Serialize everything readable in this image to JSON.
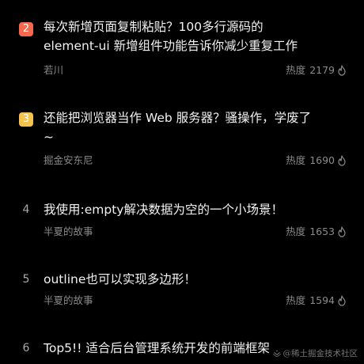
{
  "colors": {
    "background": "#000000",
    "rank_2_badge": "#f5694e",
    "rank_3_badge": "#f7c34f",
    "meta_text": "#8a8a8a"
  },
  "items": [
    {
      "rank": "2",
      "title_line1": "每次新增页面复制粘贴？100多行源码的",
      "title_line2": "element-ui 新增组件功能告诉你减少重复工作",
      "author": "若川",
      "heat_label": "热度",
      "heat_value": "2179",
      "heat_icon": "flame-icon"
    },
    {
      "rank": "3",
      "title_line1": "还能把浏览器当作 Web 服务器？骚操作，学废了",
      "title_line2": "~",
      "author": "掘金安东尼",
      "heat_label": "热度",
      "heat_value": "1690",
      "heat_icon": "flame-icon"
    },
    {
      "rank": "4",
      "title_line1": "我使用:empty解决数据为空的一个小场景！",
      "author": "半夏的故事",
      "heat_label": "热度",
      "heat_value": "1653",
      "heat_icon": "flame-icon"
    },
    {
      "rank": "5",
      "title_line1": "outline也可以实现多边形！",
      "author": "半夏的故事",
      "heat_label": "热度",
      "heat_value": "1594",
      "heat_icon": "flame-icon"
    },
    {
      "rank": "6",
      "title_line1": "Top5!! 适合后台管理系统开发的前端框架"
    }
  ],
  "watermark": "@稀土掘金技术社区"
}
